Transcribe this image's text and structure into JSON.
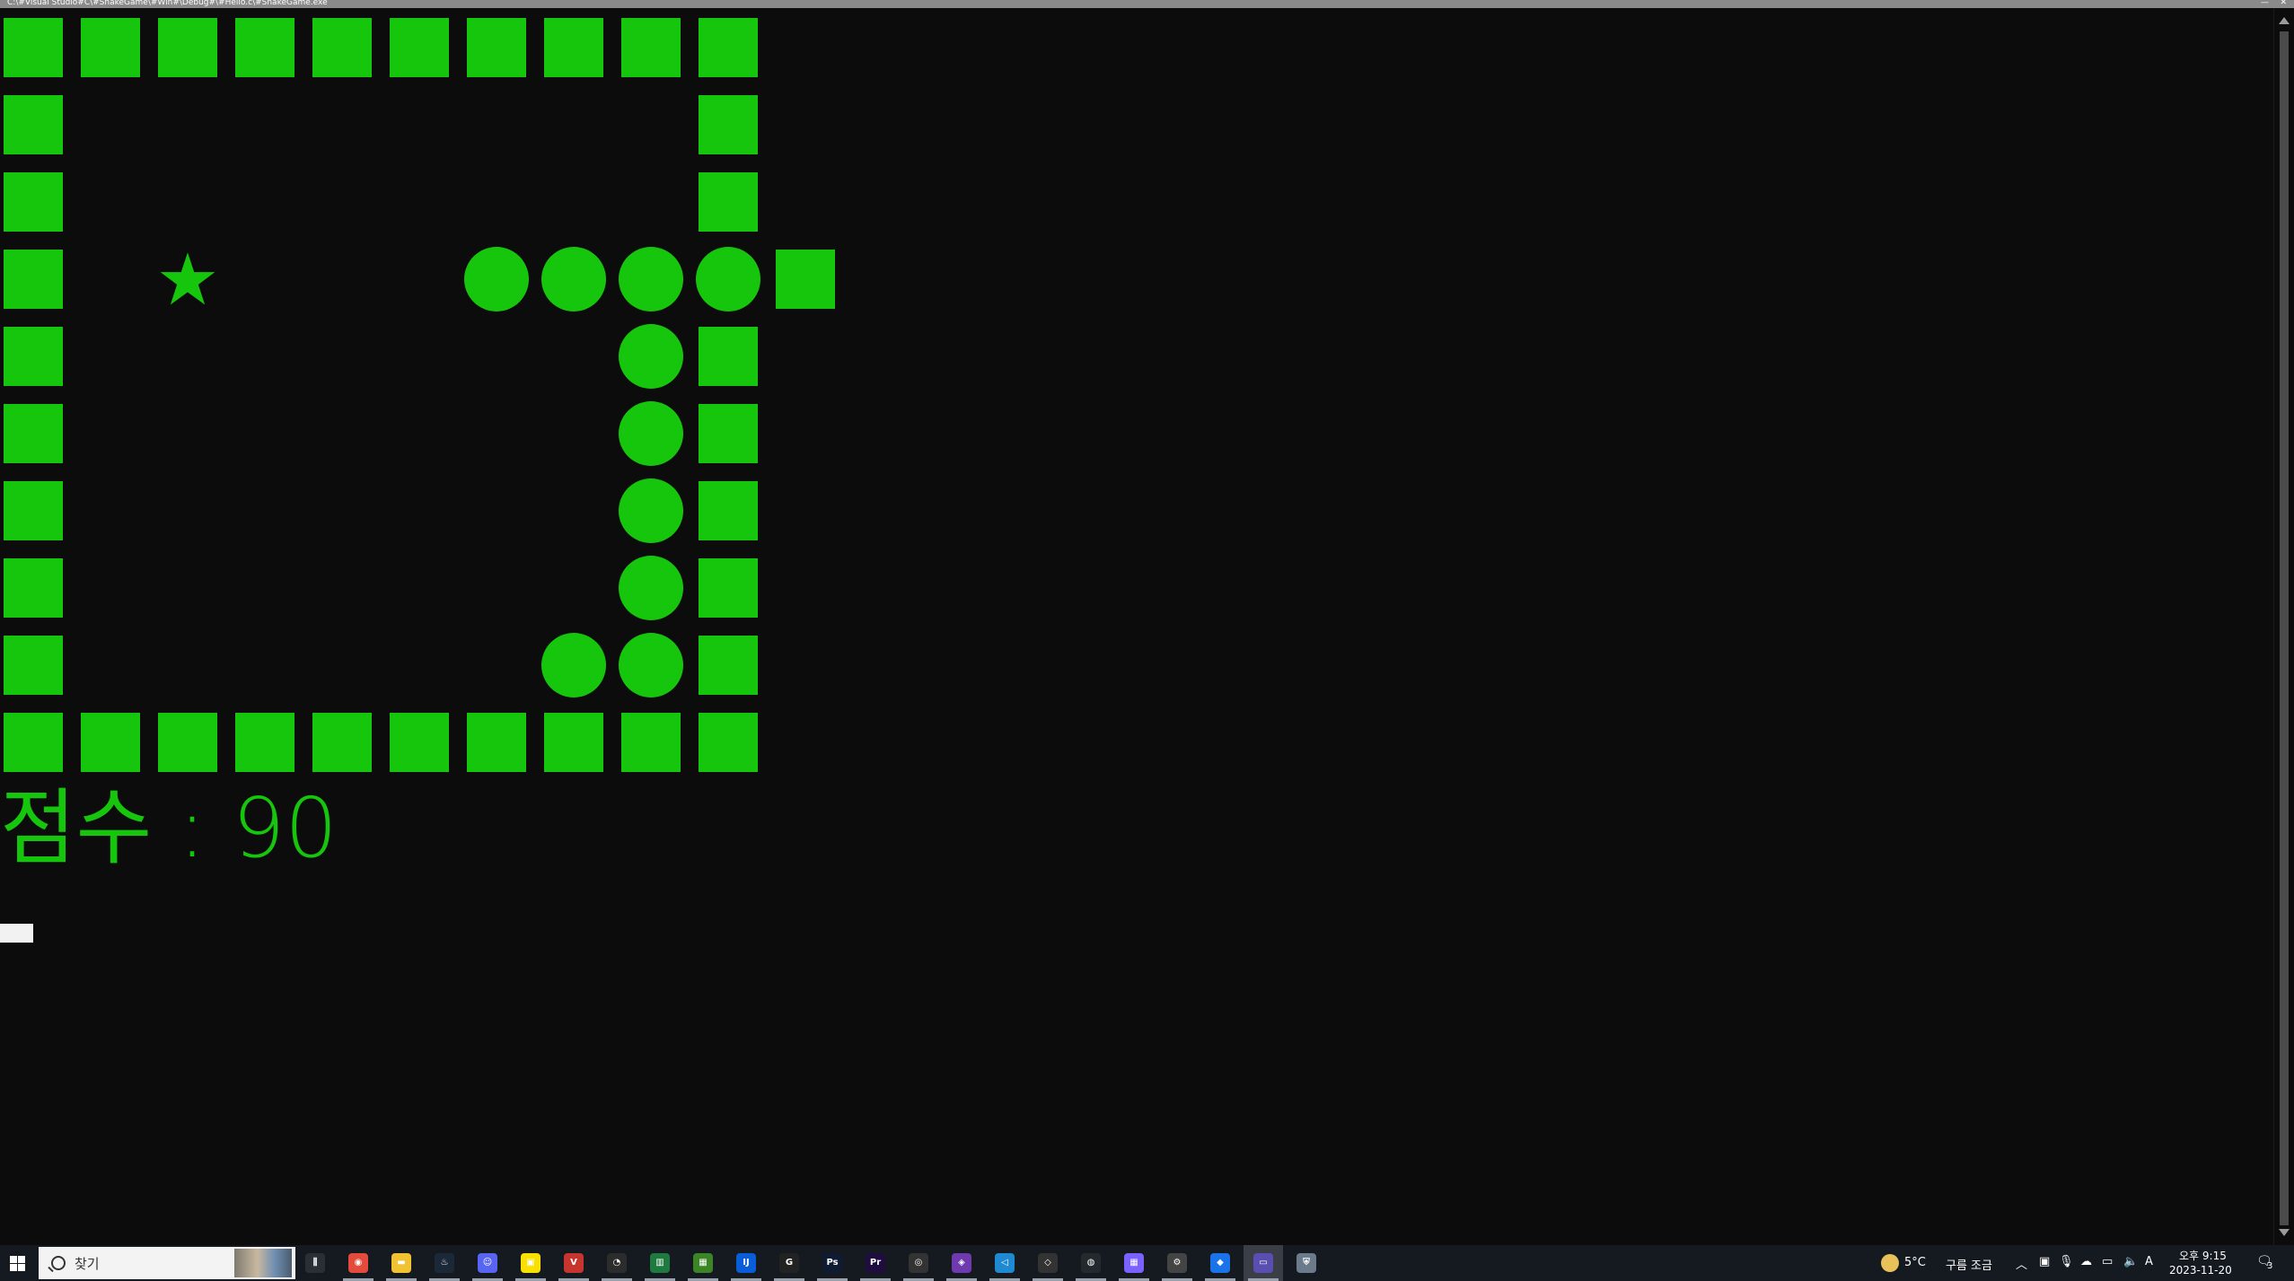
{
  "window": {
    "title": "C:\\#Visual Studio#C\\#SnakeGame\\#Win#\\Debug#\\#Hello.c\\#SnakeGame.exe"
  },
  "game": {
    "grid_cols": 10,
    "grid_rows": 10,
    "wall_symbol": "■",
    "snake_symbol": "●",
    "food_symbol": "★",
    "color": "#16c60c",
    "board": [
      "■■■■■■■■■■",
      "■        ■",
      "■        ■",
      "■ ★   ●●●●■",
      "■       ●■",
      "■       ●■",
      "■       ●■",
      "■       ●■",
      "■      ●●■",
      "■■■■■■■■■■"
    ],
    "score_label": "점수",
    "score_sep": " : ",
    "score_value": "90"
  },
  "taskbar": {
    "search_placeholder": "찾기",
    "apps": [
      "task-view-icon",
      "chrome-icon",
      "file-explorer-icon",
      "steam-icon",
      "discord-icon",
      "kakaotalk-icon",
      "vivaldi-icon",
      "overwatch-icon",
      "excel-icon",
      "minecraft-icon",
      "intellij-icon",
      "logitech-icon",
      "photoshop-icon",
      "premiere-icon",
      "obs-icon",
      "visual-studio-icon",
      "vscode-icon",
      "unity-icon",
      "github-icon",
      "app-grid-icon",
      "app-settings-icon",
      "maps-icon",
      "console-window-icon",
      "shield-icon"
    ],
    "weather_temp": "5°C",
    "weather_desc": "구름 조금",
    "ime": "A",
    "clock_period": "오후 9:15",
    "clock_date": "2023-11-20",
    "notifications": "3"
  }
}
